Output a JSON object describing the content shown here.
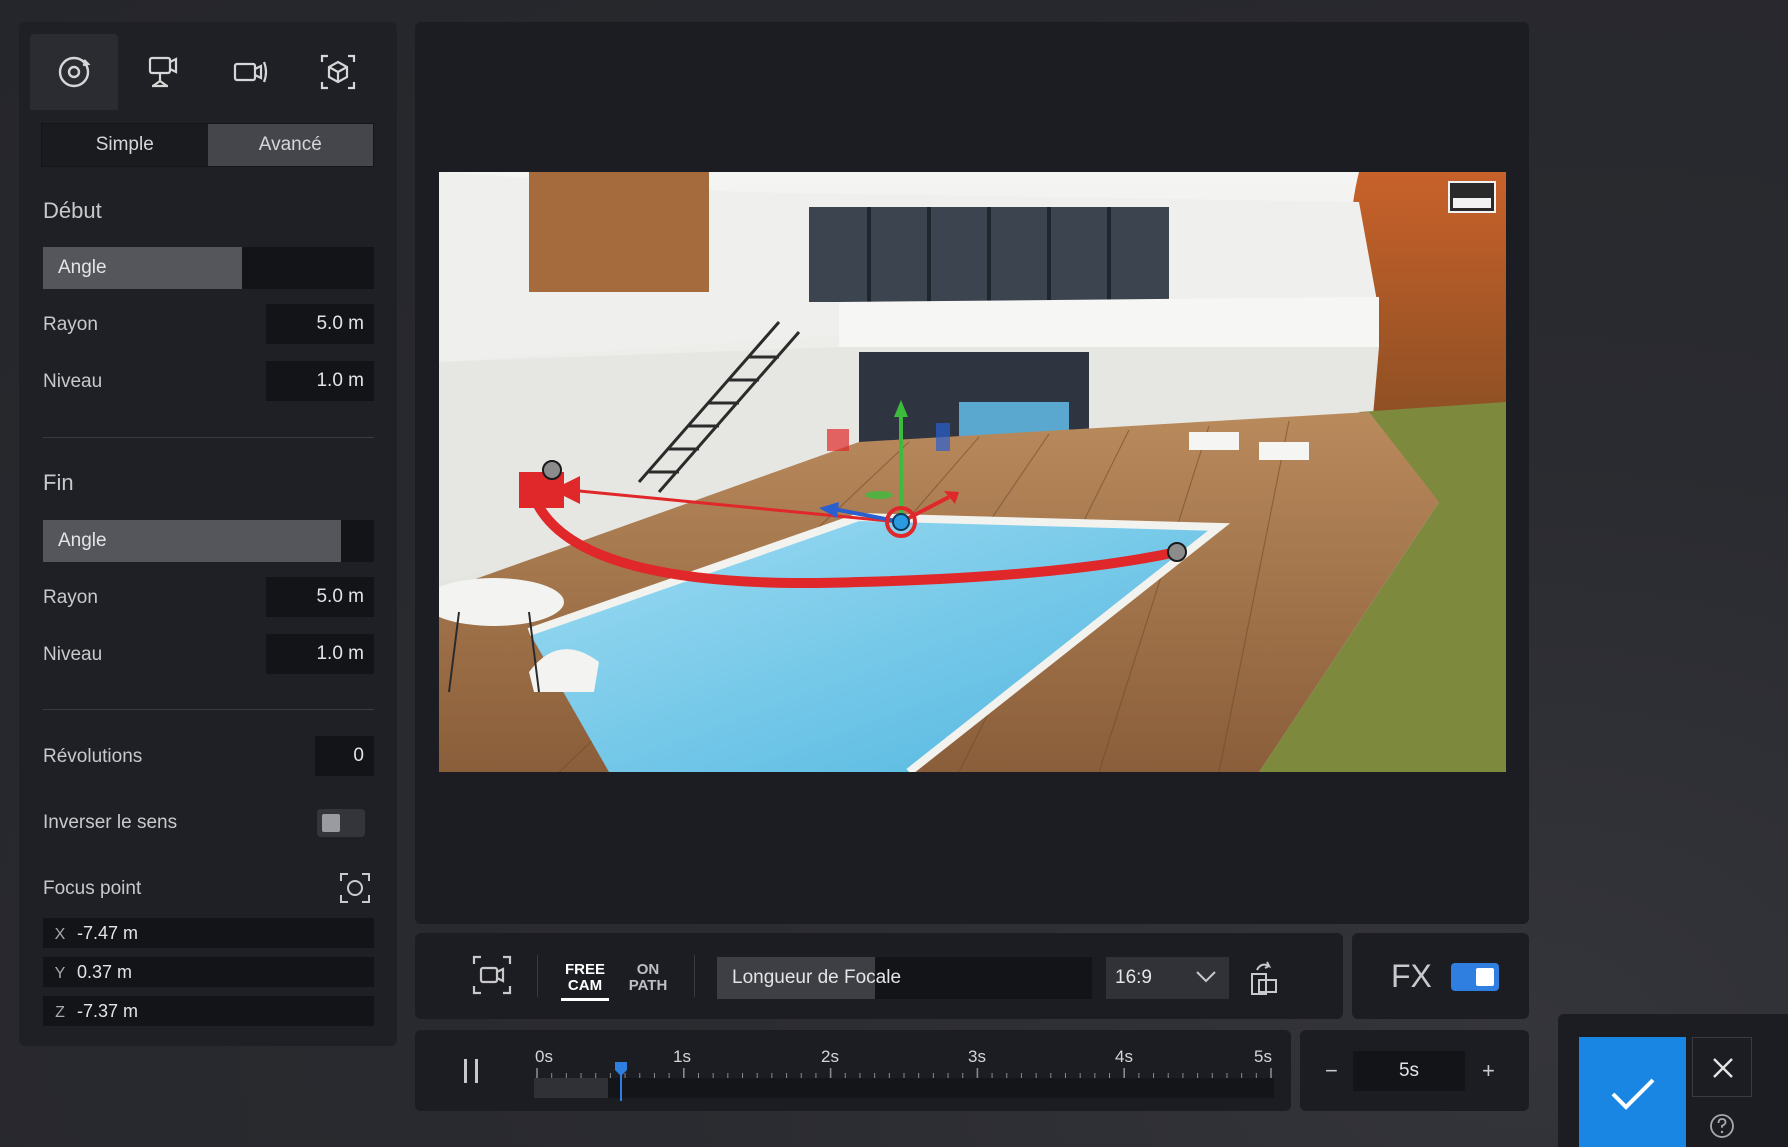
{
  "left_panel": {
    "tabs": [
      {
        "icon": "orbit-camera-icon"
      },
      {
        "icon": "tripod-camera-icon"
      },
      {
        "icon": "video-camera-icon"
      },
      {
        "icon": "cube-camera-icon"
      }
    ],
    "mode_simple": "Simple",
    "mode_advanced": "Avancé",
    "start": {
      "title": "Début",
      "angle_label": "Angle",
      "angle_value": 0.6,
      "radius_label": "Rayon",
      "radius_value": "5.0 m",
      "level_label": "Niveau",
      "level_value": "1.0 m"
    },
    "end": {
      "title": "Fin",
      "angle_label": "Angle",
      "angle_value": 0.9,
      "radius_label": "Rayon",
      "radius_value": "5.0 m",
      "level_label": "Niveau",
      "level_value": "1.0 m"
    },
    "revolutions_label": "Révolutions",
    "revolutions_value": "0",
    "reverse_label": "Inverser le sens",
    "reverse_on": false,
    "focus_label": "Focus point",
    "focus": {
      "x_axis": "X",
      "x_value": "-7.47 m",
      "y_axis": "Y",
      "y_value": "0.37 m",
      "z_axis": "Z",
      "z_value": "-7.37 m"
    }
  },
  "toolbar": {
    "mode_free_line1": "FREE",
    "mode_free_line2": "CAM",
    "mode_path_line1": "ON",
    "mode_path_line2": "PATH",
    "focal_label": "Longueur de Focale",
    "focal_value": 0.42,
    "aspect_ratio": "16:9",
    "fx_label": "FX",
    "fx_on": true
  },
  "timeline": {
    "ticks": [
      "0s",
      "1s",
      "2s",
      "3s",
      "4s",
      "5s"
    ],
    "playhead_seconds": 0.5,
    "progress": 0.1
  },
  "duration": {
    "minus": "−",
    "value": "5s",
    "plus": "+"
  },
  "colors": {
    "accent": "#1a86e4",
    "path": "#e0282a",
    "panel_bg": "#1f2025"
  }
}
